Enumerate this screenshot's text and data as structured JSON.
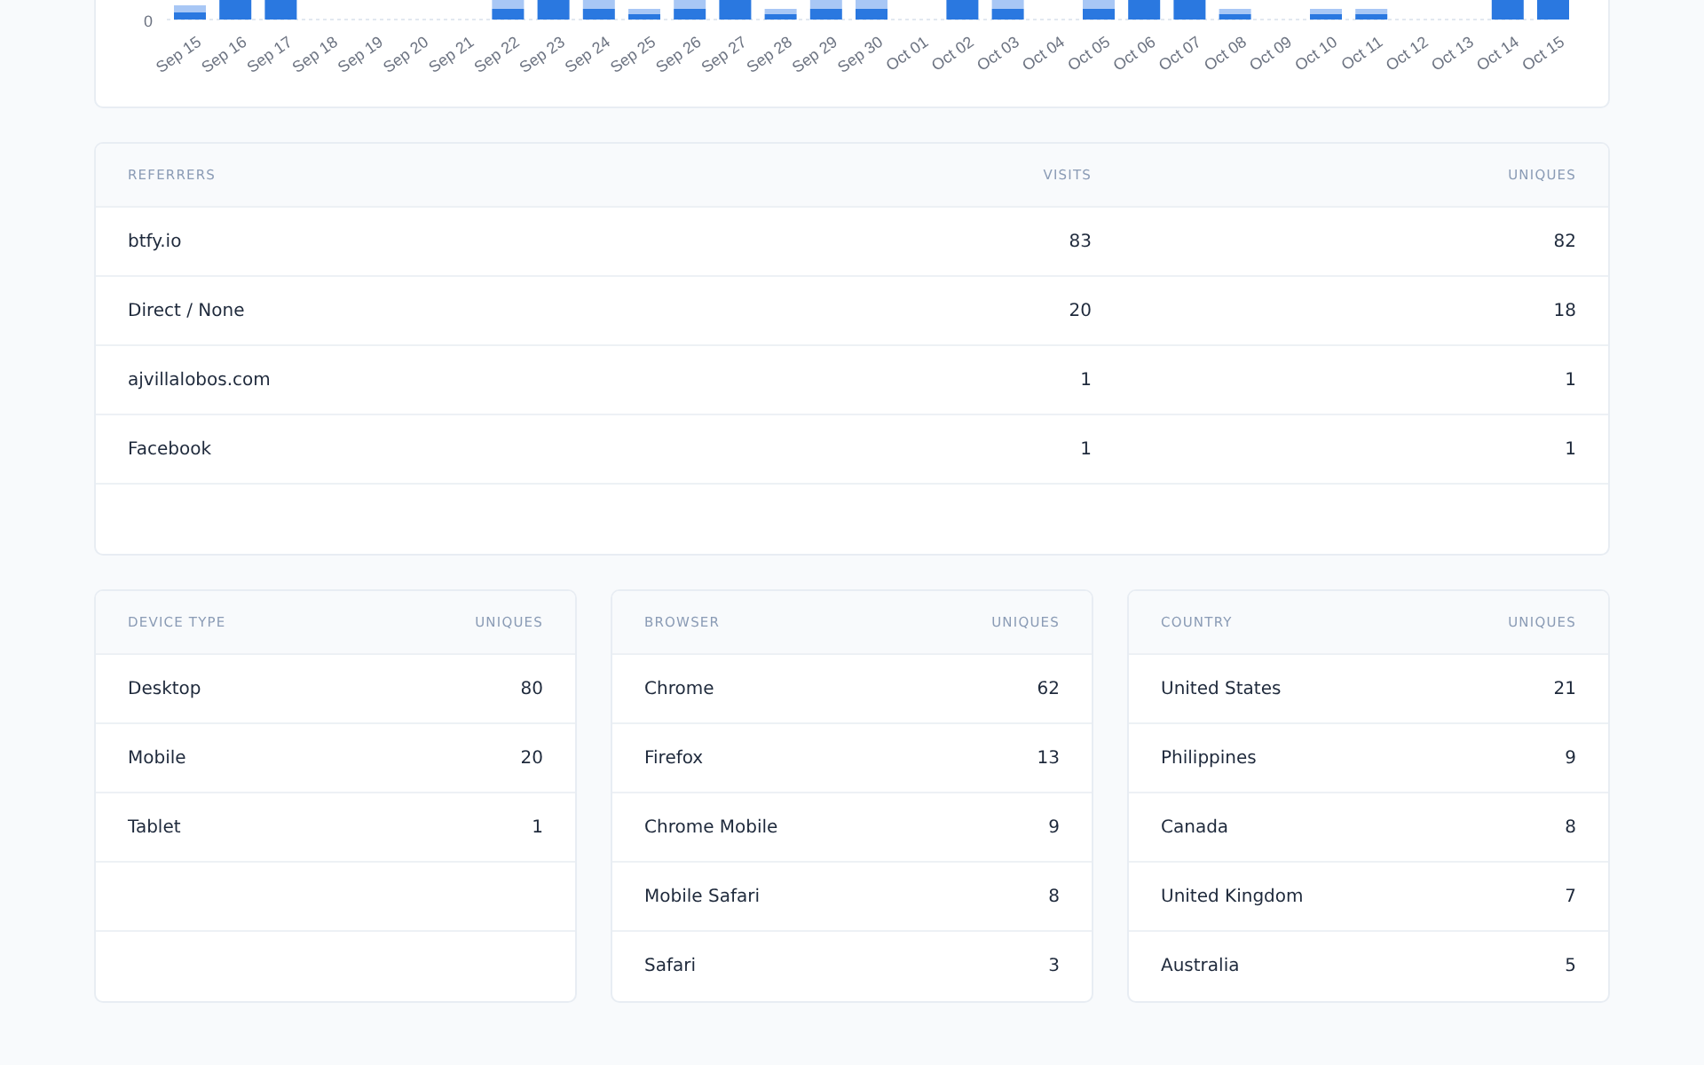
{
  "chart": {
    "y_tick": "0",
    "dates": [
      "Sep 15",
      "Sep 16",
      "Sep 17",
      "Sep 18",
      "Sep 19",
      "Sep 20",
      "Sep 21",
      "Sep 22",
      "Sep 23",
      "Sep 24",
      "Sep 25",
      "Sep 26",
      "Sep 27",
      "Sep 28",
      "Sep 29",
      "Sep 30",
      "Oct 01",
      "Oct 02",
      "Oct 03",
      "Oct 04",
      "Oct 05",
      "Oct 06",
      "Oct 07",
      "Oct 08",
      "Oct 09",
      "Oct 10",
      "Oct 11",
      "Oct 12",
      "Oct 13",
      "Oct 14",
      "Oct 15"
    ]
  },
  "referrers": {
    "columns": [
      "REFERRERS",
      "VISITS",
      "UNIQUES"
    ],
    "rows": [
      {
        "name": "btfy.io",
        "visits": "83",
        "uniques": "82"
      },
      {
        "name": "Direct / None",
        "visits": "20",
        "uniques": "18"
      },
      {
        "name": "ajvillalobos.com",
        "visits": "1",
        "uniques": "1"
      },
      {
        "name": "Facebook",
        "visits": "1",
        "uniques": "1"
      }
    ]
  },
  "panels": [
    {
      "columns": [
        "DEVICE TYPE",
        "UNIQUES"
      ],
      "rows": [
        {
          "name": "Desktop",
          "uniques": "80"
        },
        {
          "name": "Mobile",
          "uniques": "20"
        },
        {
          "name": "Tablet",
          "uniques": "1"
        }
      ]
    },
    {
      "columns": [
        "BROWSER",
        "UNIQUES"
      ],
      "rows": [
        {
          "name": "Chrome",
          "uniques": "62"
        },
        {
          "name": "Firefox",
          "uniques": "13"
        },
        {
          "name": "Chrome Mobile",
          "uniques": "9"
        },
        {
          "name": "Mobile Safari",
          "uniques": "8"
        },
        {
          "name": "Safari",
          "uniques": "3"
        }
      ]
    },
    {
      "columns": [
        "COUNTRY",
        "UNIQUES"
      ],
      "rows": [
        {
          "name": "United States",
          "uniques": "21"
        },
        {
          "name": "Philippines",
          "uniques": "9"
        },
        {
          "name": "Canada",
          "uniques": "8"
        },
        {
          "name": "United Kingdom",
          "uniques": "7"
        },
        {
          "name": "Australia",
          "uniques": "5"
        }
      ]
    }
  ]
}
